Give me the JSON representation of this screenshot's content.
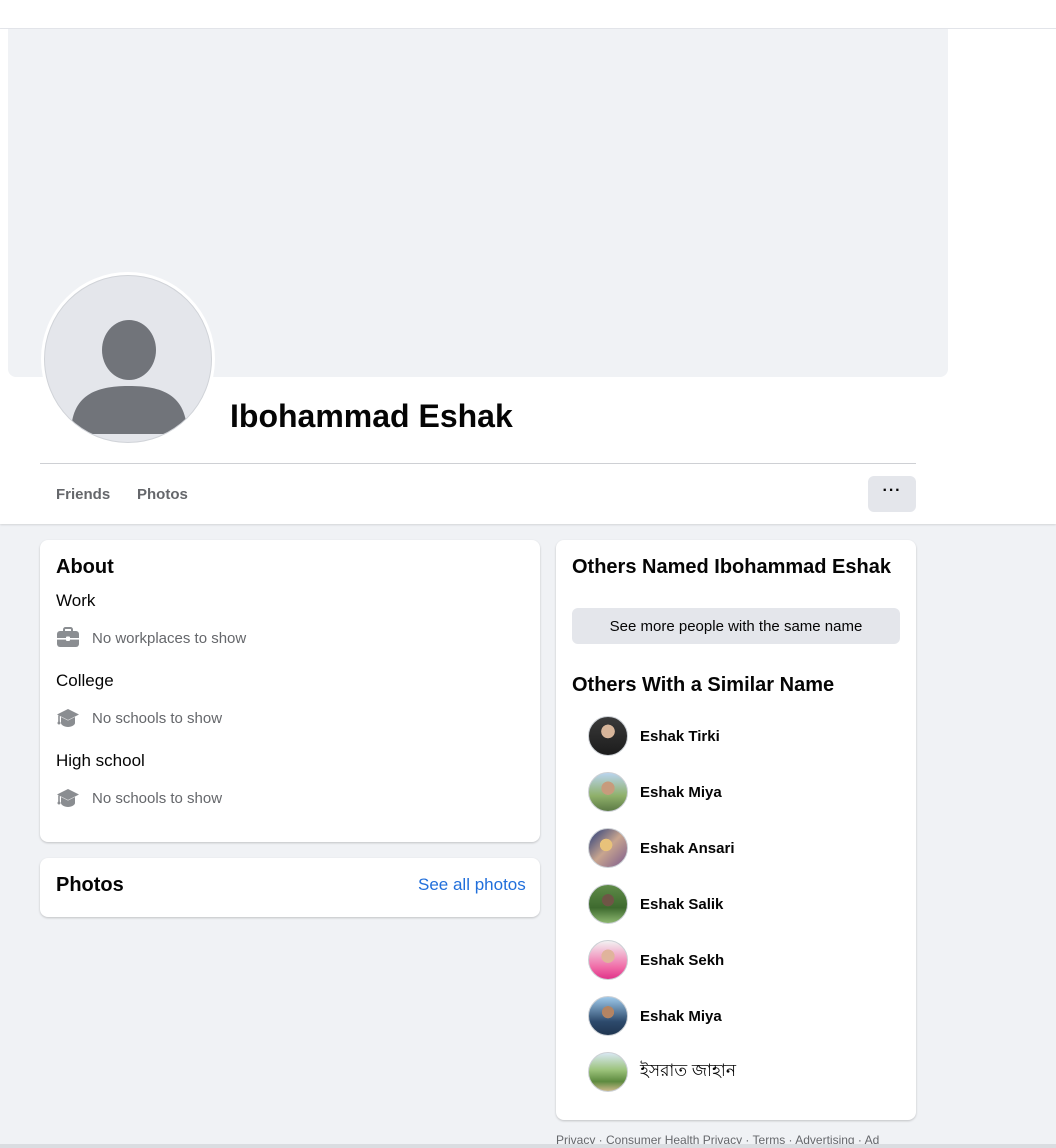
{
  "profile": {
    "name": "Ibohammad Eshak"
  },
  "tabs": [
    {
      "label": "Friends"
    },
    {
      "label": "Photos"
    }
  ],
  "more_button": {
    "label": "···"
  },
  "about": {
    "title": "About",
    "work": {
      "heading": "Work",
      "value": "No workplaces to show"
    },
    "college": {
      "heading": "College",
      "value": "No schools to show"
    },
    "high_school": {
      "heading": "High school",
      "value": "No schools to show"
    }
  },
  "photos_card": {
    "title": "Photos",
    "see_all": "See all photos"
  },
  "others_named": {
    "title": "Others Named Ibohammad Eshak",
    "see_more_button": "See more people with the same name"
  },
  "similar": {
    "title": "Others With a Similar Name",
    "people": [
      {
        "name": "Eshak Tirki"
      },
      {
        "name": "Eshak Miya"
      },
      {
        "name": "Eshak Ansari"
      },
      {
        "name": "Eshak Salik"
      },
      {
        "name": "Eshak Sekh"
      },
      {
        "name": "Eshak Miya"
      },
      {
        "name": "ইসরাত জাহান"
      }
    ]
  },
  "footer": {
    "privacy": "Privacy",
    "consumer_health": "Consumer Health Privacy",
    "terms": "Terms",
    "advertising": "Advertising",
    "ad": "Ad",
    "separator": " · "
  },
  "icons": {
    "work": "briefcase-icon",
    "college": "graduation-cap-icon",
    "high_school": "graduation-cap-icon",
    "more": "more-dots-icon"
  },
  "colors": {
    "link": "#216fdb",
    "muted_text": "#65676b",
    "background": "#f0f2f5",
    "button_gray": "#e4e6eb"
  }
}
